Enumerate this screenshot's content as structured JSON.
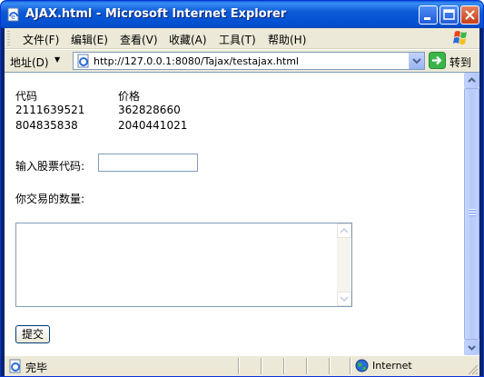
{
  "window": {
    "title": "AJAX.html - Microsoft Internet Explorer"
  },
  "menubar": {
    "items": [
      {
        "label": "文件(F)"
      },
      {
        "label": "编辑(E)"
      },
      {
        "label": "查看(V)"
      },
      {
        "label": "收藏(A)"
      },
      {
        "label": "工具(T)"
      },
      {
        "label": "帮助(H)"
      }
    ]
  },
  "addressbar": {
    "label": "地址(D)",
    "url": "http://127.0.0.1:8080/Tajax/testajax.html",
    "go_label": "转到"
  },
  "page": {
    "table": {
      "headers": [
        "代码",
        "价格"
      ],
      "rows": [
        [
          "2111639521",
          "362828660"
        ],
        [
          "804835838",
          "2040441021"
        ]
      ]
    },
    "stock_code_label": "输入股票代码:",
    "stock_code_value": "",
    "quantity_label": "你交易的数量:",
    "quantity_value": "",
    "submit_label": "提交"
  },
  "statusbar": {
    "status_text": "完毕",
    "zone": "Internet"
  },
  "colors": {
    "titlebar": "#0250d0",
    "chrome": "#ece9d8",
    "field_border": "#7f9db9"
  }
}
